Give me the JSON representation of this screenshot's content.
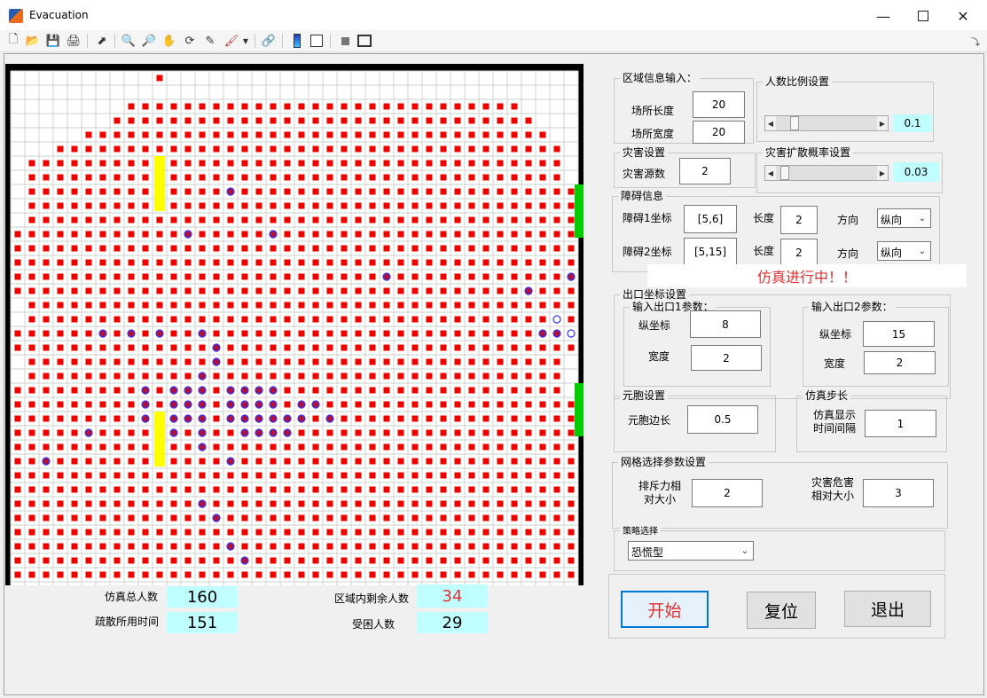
{
  "window": {
    "title": "Evacuation"
  },
  "grid": {
    "rows": 40,
    "cols": 40,
    "rowPatterns": [
      "0000000000100000000000000000000000000000",
      "0000000000000000000000000000000000000000",
      "0000000011111111111111111111111111110000",
      "0000000111111111111111111111111111111000",
      "0000011111111111111111111111111111111100",
      "0001111111111111111111111111111111111110",
      "0111111111111111111111111111111111111110",
      "0111111111111111111111111111111111111110",
      "0111111111111111111111111111111111111111",
      "0111111111111111111111111111111111111111",
      "0111111111111111111111111111111111111111",
      "1111111111111111111111111111111111111111",
      "1111111111111111111111111111111111111111",
      "1111111111111111111111111111111111111111",
      "1111111111111111111111111111111111111111",
      "1111111111111111111111111111111111111111",
      "0111111111111111111111111111111111111111",
      "0111111111111111111111111111111111111111",
      "1111111111111111111111111111111111111111",
      "1111111111111111111111111111111111111111",
      "0111111111111111111111111111111111111110",
      "0111111111111111111111111111111111111110",
      "1111111111111111111111111111111111111110",
      "1111111111111111111111111111111111111111",
      "1111111111111111111111111111111111111111",
      "1111111111111111111111111111111111111111",
      "1111111111111111111111111111111111111111",
      "1111111111111111111111111111111111111111",
      "1111111111111111111111111111111111111111",
      "1111111111111111111111111111111111111111",
      "1111111111111111111111111111111111111111",
      "1111111111111111111111111111111111111111",
      "1111111111111111111111111111111111111111",
      "1111111111111111111111111111111111111111",
      "1111111111111111111111111111111111111111",
      "1111111111111111111111111111111111111111",
      "1111111111111111111111111111111111111111",
      "1111111111111111111111111111111111111111",
      "0011111111111111111111111111111111111111",
      "0000000000000000000000000000000000000000"
    ],
    "trapped": [
      [
        8,
        15
      ],
      [
        11,
        12
      ],
      [
        11,
        18
      ],
      [
        14,
        26
      ],
      [
        15,
        36
      ],
      [
        14,
        39
      ],
      [
        18,
        6
      ],
      [
        18,
        8
      ],
      [
        18,
        10
      ],
      [
        18,
        13
      ],
      [
        19,
        14
      ],
      [
        20,
        14
      ],
      [
        21,
        13
      ],
      [
        22,
        9
      ],
      [
        22,
        11
      ],
      [
        22,
        12
      ],
      [
        22,
        13
      ],
      [
        22,
        15
      ],
      [
        22,
        16
      ],
      [
        22,
        17
      ],
      [
        22,
        18
      ],
      [
        23,
        9
      ],
      [
        23,
        11
      ],
      [
        23,
        12
      ],
      [
        23,
        13
      ],
      [
        23,
        15
      ],
      [
        23,
        16
      ],
      [
        23,
        17
      ],
      [
        23,
        18
      ],
      [
        23,
        20
      ],
      [
        23,
        21
      ],
      [
        24,
        9
      ],
      [
        24,
        11
      ],
      [
        24,
        12
      ],
      [
        24,
        13
      ],
      [
        24,
        15
      ],
      [
        24,
        16
      ],
      [
        24,
        17
      ],
      [
        24,
        18
      ],
      [
        24,
        19
      ],
      [
        24,
        20
      ],
      [
        24,
        22
      ],
      [
        25,
        5
      ],
      [
        25,
        11
      ],
      [
        25,
        13
      ],
      [
        25,
        16
      ],
      [
        25,
        17
      ],
      [
        25,
        18
      ],
      [
        25,
        19
      ],
      [
        26,
        13
      ],
      [
        27,
        2
      ],
      [
        27,
        15
      ],
      [
        30,
        13
      ],
      [
        31,
        14
      ],
      [
        33,
        15
      ],
      [
        34,
        16
      ],
      [
        18,
        38
      ],
      [
        18,
        37
      ]
    ],
    "evacuating": [
      [
        17,
        38
      ],
      [
        18,
        39
      ]
    ],
    "fires": [
      {
        "row": 6,
        "col": 10,
        "len": 4
      },
      {
        "row": 24,
        "col": 10,
        "len": 4
      }
    ],
    "exits": [
      {
        "row": 8,
        "len": 4
      },
      {
        "row": 22,
        "len": 4
      }
    ],
    "colors": {
      "person": "#ee0000",
      "trappedFill": "#b0103a",
      "trappedRing": "#3030ff",
      "fire": "#ffff00",
      "exit": "#00cc00"
    }
  },
  "stats": {
    "total_label": "仿真总人数",
    "total_value": "160",
    "time_label": "疏散所用时间",
    "time_value": "151",
    "remaining_label": "区域内剩余人数",
    "remaining_value": "34",
    "trapped_label": "受困人数",
    "trapped_value": "29"
  },
  "area": {
    "title": "区域信息输入：",
    "length_label": "场所长度",
    "length_value": "20",
    "width_label": "场所宽度",
    "width_value": "20"
  },
  "ratio": {
    "title": "人数比例设置",
    "value": "0.1",
    "fraction": 0.15
  },
  "disaster": {
    "title": "灾害设置",
    "source_label": "灾害源数",
    "source_value": "2"
  },
  "spread": {
    "title": "灾害扩散概率设置",
    "value": "0.03",
    "fraction": 0.05
  },
  "obstacle": {
    "title": "障碍信息",
    "o1_label": "障碍1坐标",
    "o1_value": "[5,6]",
    "o2_label": "障碍2坐标",
    "o2_value": "[5,15]",
    "len_label": "长度",
    "len1": "2",
    "len2": "2",
    "dir_label": "方向",
    "dir1": "纵向",
    "dir2": "纵向"
  },
  "status": "仿真进行中！！",
  "exit": {
    "title": "出口坐标设置",
    "e1_title": "输入出口1参数：",
    "e2_title": "输入出口2参数：",
    "y_label": "纵坐标",
    "w_label": "宽度",
    "e1_y": "8",
    "e1_w": "2",
    "e2_y": "15",
    "e2_w": "2"
  },
  "cell": {
    "title": "元胞设置",
    "label": "元胞边长",
    "value": "0.5"
  },
  "step": {
    "title": "仿真步长",
    "label": "仿真显示\n时间间隔",
    "value": "1"
  },
  "gridsel": {
    "title": "网格选择参数设置",
    "repel_label": "排斥力相\n对大小",
    "repel_value": "2",
    "hazard_label": "灾害危害\n相对大小",
    "hazard_value": "3"
  },
  "strategy": {
    "title": "策略选择",
    "value": "恐慌型"
  },
  "buttons": {
    "start": "开始",
    "reset": "复位",
    "exit": "退出"
  }
}
